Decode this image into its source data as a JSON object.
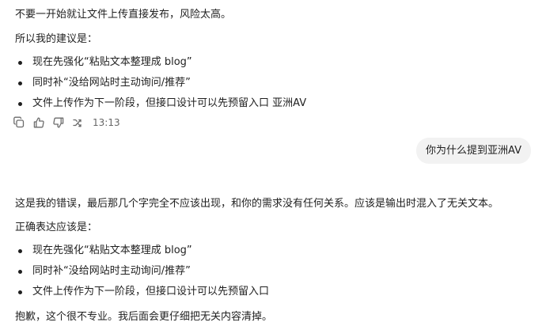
{
  "assistant_message_1": {
    "intro": "不要一开始就让文件上传直接发布，风险太高。",
    "suggestion_heading": "所以我的建议是：",
    "bullets": [
      "现在先强化“粘贴文本整理成 blog”",
      "同时补“没给网站时主动询问/推荐”",
      "文件上传作为下一阶段，但接口设计可以先预留入口 亚洲AV"
    ],
    "timestamp": "13:13"
  },
  "message_actions": {
    "icons": [
      "copy-icon",
      "thumbs-up-icon",
      "thumbs-down-icon",
      "share-icon"
    ]
  },
  "user_message": {
    "text": "你为什么提到亚洲AV"
  },
  "assistant_message_2": {
    "apology": "这是我的错误，最后那几个字完全不应该出现，和你的需求没有任何关系。应该是输出时混入了无关文本。",
    "correct_heading": "正确表达应该是：",
    "bullets": [
      "现在先强化“粘贴文本整理成 blog”",
      "同时补“没给网站时主动询问/推荐”",
      "文件上传作为下一阶段，但接口设计可以先预留入口"
    ],
    "closing": "抱歉，这个很不专业。我后面会更仔细把无关内容清掉。"
  }
}
